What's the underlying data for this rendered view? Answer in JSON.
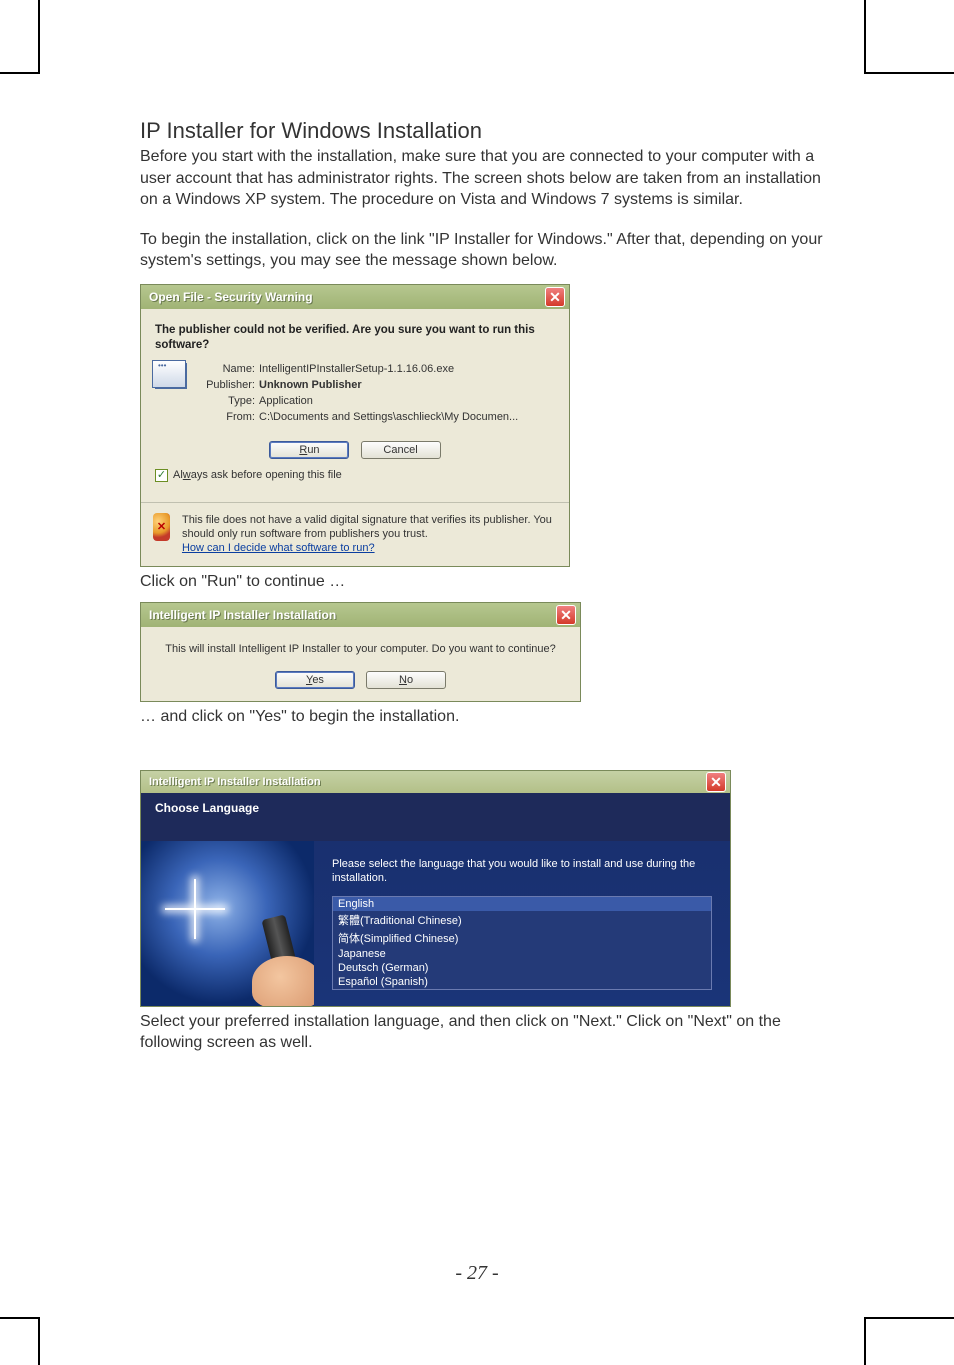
{
  "heading": "IP Installer for Windows Installation",
  "para1": "Before you start with the installation, make sure that you are connected to your computer with a user account that has administrator rights. The screen shots below are taken from an installation on a Windows XP system. The procedure on Vista and Windows 7 systems is similar.",
  "para2": "To begin the installation, click on the link \"IP Installer for Windows.\" After that, depending on your system's settings, you may see the message shown below.",
  "dialog1": {
    "title": "Open File - Security Warning",
    "headline": "The publisher could not be verified.  Are you sure you want to run this software?",
    "name_label": "Name:",
    "name_value": "IntelligentIPInstallerSetup-1.1.16.06.exe",
    "publisher_label": "Publisher:",
    "publisher_value": "Unknown Publisher",
    "type_label": "Type:",
    "type_value": "Application",
    "from_label": "From:",
    "from_value": "C:\\Documents and Settings\\aschlieck\\My Documen...",
    "run": "Run",
    "cancel": "Cancel",
    "always_ask": "Always ask before opening this file",
    "footer_text": "This file does not have a valid digital signature that verifies its publisher.  You should only run software from publishers you trust.",
    "footer_link": "How can I decide what software to run?"
  },
  "caption1": "Click on \"Run\" to continue …",
  "dialog2": {
    "title": "Intelligent IP Installer Installation",
    "message": "This will install Intelligent IP Installer to your computer. Do you want to continue?",
    "yes": "Yes",
    "no": "No"
  },
  "caption2": "… and click on \"Yes\" to begin the installation.",
  "dialog3": {
    "title": "Intelligent IP Installer Installation",
    "subtitle": "Choose Language",
    "instruction": "Please select the language that you would like to install and use during the installation.",
    "languages": [
      "English",
      "繁體(Traditional Chinese)",
      "简体(Simplified Chinese)",
      "Japanese",
      "Deutsch (German)",
      "Español (Spanish)"
    ]
  },
  "caption3": "Select your preferred installation language, and then click on \"Next.\" Click on \"Next\" on the following screen as well.",
  "page_number": "- 27 -"
}
